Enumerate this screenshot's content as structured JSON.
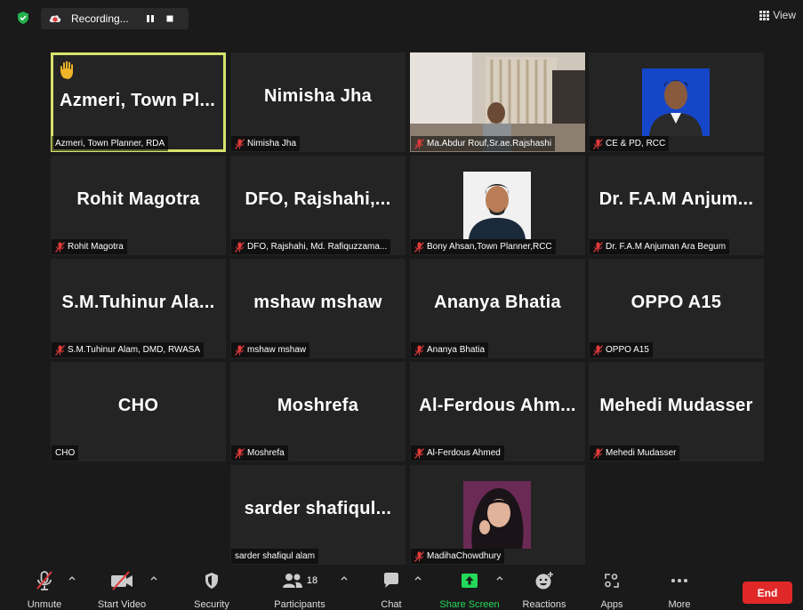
{
  "topbar": {
    "recording_label": "Recording...",
    "view_label": "View"
  },
  "tiles": [
    {
      "name": "Azmeri,  Town  Pl...",
      "label": "Azmeri, Town Planner, RDA",
      "muted": false,
      "active": true,
      "hand_raised": true
    },
    {
      "name": "Nimisha Jha",
      "label": "Nimisha Jha",
      "muted": true
    },
    {
      "name": "",
      "label": "Ma.Abdur Rouf,Sr.ae.Rajshashi",
      "muted": true,
      "video": true
    },
    {
      "name": "",
      "label": "CE & PD, RCC",
      "muted": true,
      "photo": "portrait-blue"
    },
    {
      "name": "Rohit Magotra",
      "label": "Rohit Magotra",
      "muted": true
    },
    {
      "name": "DFO,  Rajshahi,...",
      "label": "DFO, Rajshahi, Md. Rafiquzzama...",
      "muted": true
    },
    {
      "name": "",
      "label": "Bony Ahsan,Town Planner,RCC",
      "muted": true,
      "photo": "portrait-man"
    },
    {
      "name": "Dr.  F.A.M  Anjum...",
      "label": "Dr. F.A.M Anjuman Ara Begum",
      "muted": true
    },
    {
      "name": "S.M.Tuhinur  Ala...",
      "label": "S.M.Tuhinur Alam, DMD, RWASA",
      "muted": true
    },
    {
      "name": "mshaw  mshaw",
      "label": "mshaw mshaw",
      "muted": true
    },
    {
      "name": "Ananya Bhatia",
      "label": "Ananya Bhatia",
      "muted": true
    },
    {
      "name": "OPPO A15",
      "label": "OPPO A15",
      "muted": true
    },
    {
      "name": "CHO",
      "label": "CHO",
      "muted": false
    },
    {
      "name": "Moshrefa",
      "label": "Moshrefa",
      "muted": true
    },
    {
      "name": "Al-Ferdous  Ahm...",
      "label": "Al-Ferdous Ahmed",
      "muted": true
    },
    {
      "name": "Mehedi Mudasser",
      "label": "Mehedi Mudasser",
      "muted": true
    },
    {
      "name": "sarder  shafiqul...",
      "label": "sarder shafiqul alam",
      "muted": false
    },
    {
      "name": "",
      "label": "MadihaChowdhury",
      "muted": true,
      "photo": "portrait-woman"
    }
  ],
  "toolbar": {
    "unmute": "Unmute",
    "start_video": "Start Video",
    "security": "Security",
    "participants": "Participants",
    "participant_count": "18",
    "chat": "Chat",
    "share_screen": "Share Screen",
    "reactions": "Reactions",
    "apps": "Apps",
    "more": "More",
    "end": "End"
  },
  "colors": {
    "active_border": "#d6e36b",
    "end_button": "#e02828",
    "share_green": "#23d959",
    "muted_red": "#e03a3a"
  }
}
